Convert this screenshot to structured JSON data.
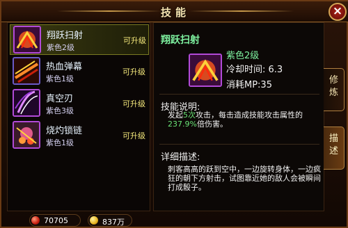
{
  "window": {
    "title": "技能"
  },
  "skills": [
    {
      "name": "翔跃扫射",
      "grade": "紫色2级",
      "status": "可升级"
    },
    {
      "name": "热血弹幕",
      "grade": "紫色1级",
      "status": "可升级"
    },
    {
      "name": "真空刃",
      "grade": "紫色3级",
      "status": "可升级"
    },
    {
      "name": "烧灼锁链",
      "grade": "紫色1级",
      "status": "可升级"
    }
  ],
  "selected_index": 0,
  "detail": {
    "name": "翔跃扫射",
    "grade": "紫色2级",
    "cooldown": "冷却时间: 6.3",
    "mp_cost": "消耗MP:35",
    "skill_desc_title": "技能说明:",
    "skill_desc": {
      "p1": "发起",
      "hits": "5次",
      "p2": "攻击，每击造成技能攻击属性的",
      "percent": "237.9%",
      "p3": "倍伤害。"
    },
    "detail_title": "详细描述:",
    "detail_text": "刺客高高的跃到空中，一边旋转身体，一边疯狂的朝下方射击，试图靠近她的敌人会被瞬间打成骰子。"
  },
  "tabs": [
    {
      "label": "修炼",
      "active": false
    },
    {
      "label": "描述",
      "active": true
    }
  ],
  "currency": {
    "red": "70705",
    "gold": "837万"
  },
  "colors": {
    "accent_green": "#6ae276",
    "upgrade_yellow": "#f2e67a",
    "icon_border_purple": "#b24ad8"
  }
}
